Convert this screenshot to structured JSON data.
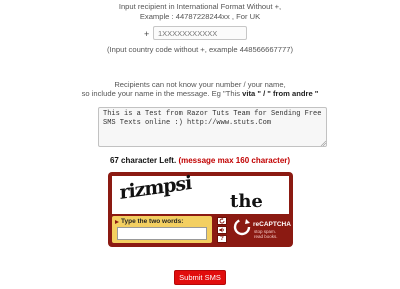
{
  "recipient": {
    "instruction_line1": "Input recipient in International Format Without +,",
    "instruction_line2": "Example : 44787228244xx , For UK",
    "plus_prefix": "+",
    "placeholder": "1XXXXXXXXXXX",
    "hint": "(Input country code without +, example 448566667777)"
  },
  "name_notice": {
    "line1": "Recipients can not know your number / your name,",
    "line2_prefix": "so include your name in the message. Eg \"This ",
    "line2_vita": "vita",
    "line2_mid": " \" / \" ",
    "line2_from": "from andre",
    "line2_suffix": " \""
  },
  "message": {
    "value": "This is a Test from Razor Tuts Team for Sending Free SMS Texts online :) http://www.stuts.Com"
  },
  "counter": {
    "count_text": "67 character Left.",
    "max_text": "(message max 160 character)"
  },
  "captcha": {
    "word1": "rizmpsi",
    "word2": "the",
    "input_label": "Type the two words:",
    "brand": "reCAPTCHA",
    "tagline1": "stop spam.",
    "tagline2": "read books.",
    "icon_refresh": "refresh-icon",
    "icon_audio": "audio-icon",
    "icon_help": "help-icon"
  },
  "actions": {
    "submit_label": "Submit SMS"
  },
  "colors": {
    "captcha_frame": "#8b1a12",
    "captcha_input_panel": "#f3cf61",
    "submit_button": "#e10d0d",
    "warning_text": "#c10000"
  }
}
